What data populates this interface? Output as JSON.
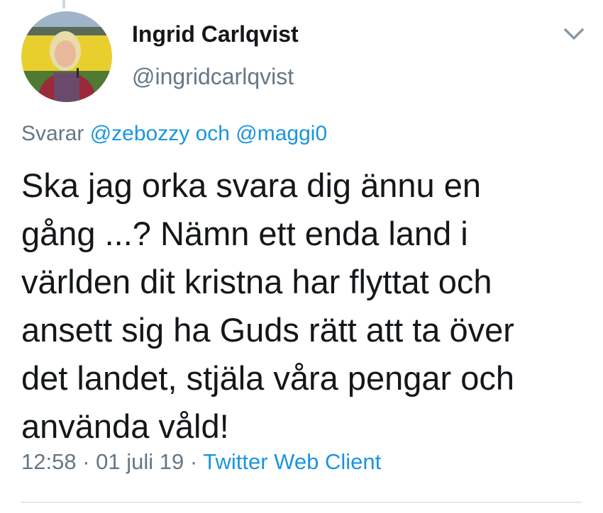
{
  "tweet": {
    "author": {
      "display_name": "Ingrid Carlqvist",
      "handle": "@ingridcarlqvist"
    },
    "reply_context": {
      "prefix": "Svarar",
      "mention_1": "@zebozzy",
      "joiner": "och",
      "mention_2": "@maggi0"
    },
    "text_lines": [
      "Ska jag orka svara dig ännu en",
      "gång ...? Nämn ett enda land i",
      "världen dit kristna har flyttat och",
      "ansett sig ha Guds rätt att ta över",
      "det landet, stjäla våra pengar och",
      "använda våld!"
    ],
    "meta": {
      "time": "12:58",
      "separator": "·",
      "date": "01 juli 19",
      "source": "Twitter Web Client"
    }
  },
  "icons": {
    "menu": "chevron-down-icon",
    "avatar": "profile-photo"
  },
  "colors": {
    "text": "#14171a",
    "secondary": "#657786",
    "link": "#1b95e0",
    "divider": "#e1e8ed"
  }
}
